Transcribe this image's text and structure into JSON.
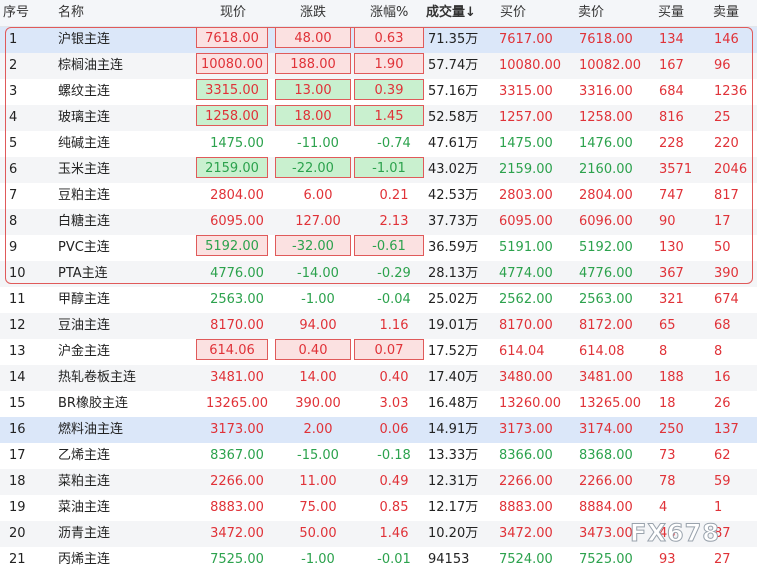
{
  "headers": {
    "seq": "序号",
    "name": "名称",
    "price": "现价",
    "change": "涨跌",
    "pct": "涨幅%",
    "volume": "成交量",
    "sort_icon": "↓",
    "bid": "买价",
    "ask": "卖价",
    "bidvol": "买量",
    "askvol": "卖量"
  },
  "colors": {
    "up": "#e03238",
    "down": "#2ca24d",
    "selected_row": "#dbe7f9",
    "highlight_red": "#fbe1e1",
    "highlight_green": "#c9f0cf"
  },
  "rows": [
    {
      "seq": "1",
      "name": "沪银主连",
      "price": "7618.00",
      "change": "48.00",
      "pct": "0.63",
      "volume": "71.35万",
      "bid": "7617.00",
      "ask": "7618.00",
      "bidvol": "134",
      "askvol": "146",
      "dir": "up",
      "box": "red",
      "selected": true
    },
    {
      "seq": "2",
      "name": "棕榈油主连",
      "price": "10080.00",
      "change": "188.00",
      "pct": "1.90",
      "volume": "57.74万",
      "bid": "10080.00",
      "ask": "10082.00",
      "bidvol": "167",
      "askvol": "96",
      "dir": "up",
      "box": "red"
    },
    {
      "seq": "3",
      "name": "螺纹主连",
      "price": "3315.00",
      "change": "13.00",
      "pct": "0.39",
      "volume": "57.16万",
      "bid": "3315.00",
      "ask": "3316.00",
      "bidvol": "684",
      "askvol": "1236",
      "dir": "up",
      "box": "green"
    },
    {
      "seq": "4",
      "name": "玻璃主连",
      "price": "1258.00",
      "change": "18.00",
      "pct": "1.45",
      "volume": "52.58万",
      "bid": "1257.00",
      "ask": "1258.00",
      "bidvol": "816",
      "askvol": "25",
      "dir": "up",
      "box": "green"
    },
    {
      "seq": "5",
      "name": "纯碱主连",
      "price": "1475.00",
      "change": "-11.00",
      "pct": "-0.74",
      "volume": "47.61万",
      "bid": "1475.00",
      "ask": "1476.00",
      "bidvol": "228",
      "askvol": "220",
      "dir": "down",
      "box": ""
    },
    {
      "seq": "6",
      "name": "玉米主连",
      "price": "2159.00",
      "change": "-22.00",
      "pct": "-1.01",
      "volume": "43.02万",
      "bid": "2159.00",
      "ask": "2160.00",
      "bidvol": "3571",
      "askvol": "2046",
      "dir": "down",
      "box": "green"
    },
    {
      "seq": "7",
      "name": "豆粕主连",
      "price": "2804.00",
      "change": "6.00",
      "pct": "0.21",
      "volume": "42.53万",
      "bid": "2803.00",
      "ask": "2804.00",
      "bidvol": "747",
      "askvol": "817",
      "dir": "up",
      "box": ""
    },
    {
      "seq": "8",
      "name": "白糖主连",
      "price": "6095.00",
      "change": "127.00",
      "pct": "2.13",
      "volume": "37.73万",
      "bid": "6095.00",
      "ask": "6096.00",
      "bidvol": "90",
      "askvol": "17",
      "dir": "up",
      "box": ""
    },
    {
      "seq": "9",
      "name": "PVC主连",
      "price": "5192.00",
      "change": "-32.00",
      "pct": "-0.61",
      "volume": "36.59万",
      "bid": "5191.00",
      "ask": "5192.00",
      "bidvol": "130",
      "askvol": "50",
      "dir": "down",
      "box": "red"
    },
    {
      "seq": "10",
      "name": "PTA主连",
      "price": "4776.00",
      "change": "-14.00",
      "pct": "-0.29",
      "volume": "28.13万",
      "bid": "4774.00",
      "ask": "4776.00",
      "bidvol": "367",
      "askvol": "390",
      "dir": "down",
      "box": ""
    },
    {
      "seq": "11",
      "name": "甲醇主连",
      "price": "2563.00",
      "change": "-1.00",
      "pct": "-0.04",
      "volume": "25.02万",
      "bid": "2562.00",
      "ask": "2563.00",
      "bidvol": "321",
      "askvol": "674",
      "dir": "down",
      "box": ""
    },
    {
      "seq": "12",
      "name": "豆油主连",
      "price": "8170.00",
      "change": "94.00",
      "pct": "1.16",
      "volume": "19.01万",
      "bid": "8170.00",
      "ask": "8172.00",
      "bidvol": "65",
      "askvol": "68",
      "dir": "up",
      "box": ""
    },
    {
      "seq": "13",
      "name": "沪金主连",
      "price": "614.06",
      "change": "0.40",
      "pct": "0.07",
      "volume": "17.52万",
      "bid": "614.04",
      "ask": "614.08",
      "bidvol": "8",
      "askvol": "8",
      "dir": "up",
      "box": "red"
    },
    {
      "seq": "14",
      "name": "热轧卷板主连",
      "price": "3481.00",
      "change": "14.00",
      "pct": "0.40",
      "volume": "17.40万",
      "bid": "3480.00",
      "ask": "3481.00",
      "bidvol": "188",
      "askvol": "16",
      "dir": "up",
      "box": ""
    },
    {
      "seq": "15",
      "name": "BR橡胶主连",
      "price": "13265.00",
      "change": "390.00",
      "pct": "3.03",
      "volume": "16.48万",
      "bid": "13260.00",
      "ask": "13265.00",
      "bidvol": "18",
      "askvol": "26",
      "dir": "up",
      "box": ""
    },
    {
      "seq": "16",
      "name": "燃料油主连",
      "price": "3173.00",
      "change": "2.00",
      "pct": "0.06",
      "volume": "14.91万",
      "bid": "3173.00",
      "ask": "3174.00",
      "bidvol": "250",
      "askvol": "137",
      "dir": "up",
      "box": "",
      "tint": true
    },
    {
      "seq": "17",
      "name": "乙烯主连",
      "price": "8367.00",
      "change": "-15.00",
      "pct": "-0.18",
      "volume": "13.33万",
      "bid": "8366.00",
      "ask": "8368.00",
      "bidvol": "73",
      "askvol": "62",
      "dir": "down",
      "box": ""
    },
    {
      "seq": "18",
      "name": "菜粕主连",
      "price": "2266.00",
      "change": "11.00",
      "pct": "0.49",
      "volume": "12.31万",
      "bid": "2266.00",
      "ask": "2266.00",
      "bidvol": "78",
      "askvol": "59",
      "dir": "up",
      "box": ""
    },
    {
      "seq": "19",
      "name": "菜油主连",
      "price": "8883.00",
      "change": "75.00",
      "pct": "0.85",
      "volume": "12.17万",
      "bid": "8883.00",
      "ask": "8884.00",
      "bidvol": "4",
      "askvol": "1",
      "dir": "up",
      "box": ""
    },
    {
      "seq": "20",
      "name": "沥青主连",
      "price": "3472.00",
      "change": "50.00",
      "pct": "1.46",
      "volume": "10.20万",
      "bid": "3472.00",
      "ask": "3473.00",
      "bidvol": "46",
      "askvol": "87",
      "dir": "up",
      "box": ""
    },
    {
      "seq": "21",
      "name": "丙烯主连",
      "price": "7525.00",
      "change": "-1.00",
      "pct": "-0.01",
      "volume": "94153",
      "bid": "7524.00",
      "ask": "7525.00",
      "bidvol": "93",
      "askvol": "27",
      "dir": "down",
      "box": ""
    }
  ],
  "watermark": "FX678"
}
